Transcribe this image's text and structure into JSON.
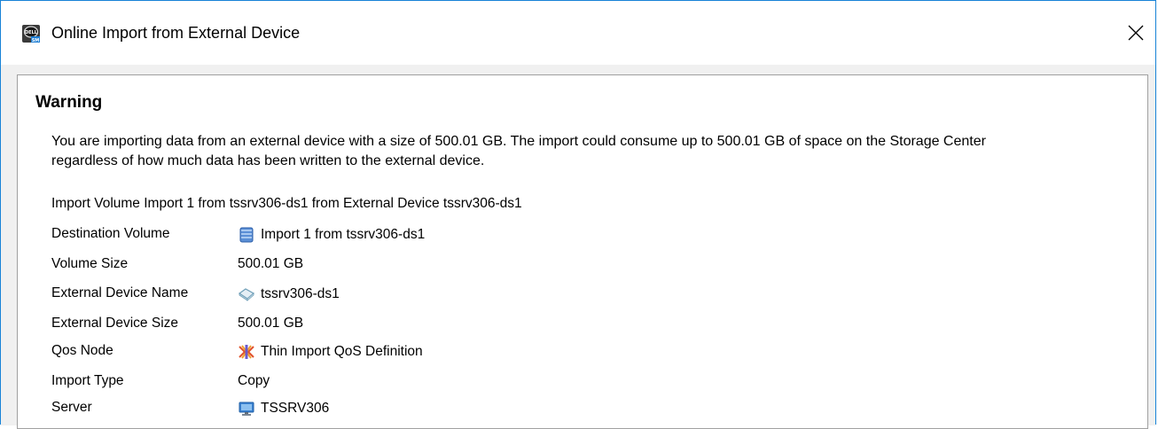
{
  "window": {
    "title": "Online Import from External Device",
    "app_icon": "dell-storage-manager-icon",
    "close_icon": "close-icon"
  },
  "warning": {
    "heading": "Warning",
    "message": "You are importing data from an external device with a size of 500.01 GB. The import could consume up to 500.01 GB of space on the Storage Center regardless of how much data has been written to the external device.",
    "import_line": "Import Volume Import 1 from tssrv306-ds1 from External Device tssrv306-ds1"
  },
  "details": [
    {
      "label": "Destination Volume",
      "value": "Import 1 from tssrv306-ds1",
      "icon": "volume-icon"
    },
    {
      "label": "Volume Size",
      "value": "500.01 GB",
      "icon": ""
    },
    {
      "label": "External Device Name",
      "value": "tssrv306-ds1",
      "icon": "external-device-icon"
    },
    {
      "label": "External Device Size",
      "value": "500.01 GB",
      "icon": ""
    },
    {
      "label": "Qos Node",
      "value": "Thin Import QoS Definition",
      "icon": "qos-node-icon"
    },
    {
      "label": "Import Type",
      "value": "Copy",
      "icon": ""
    },
    {
      "label": "Server",
      "value": "TSSRV306",
      "icon": "server-icon"
    }
  ]
}
